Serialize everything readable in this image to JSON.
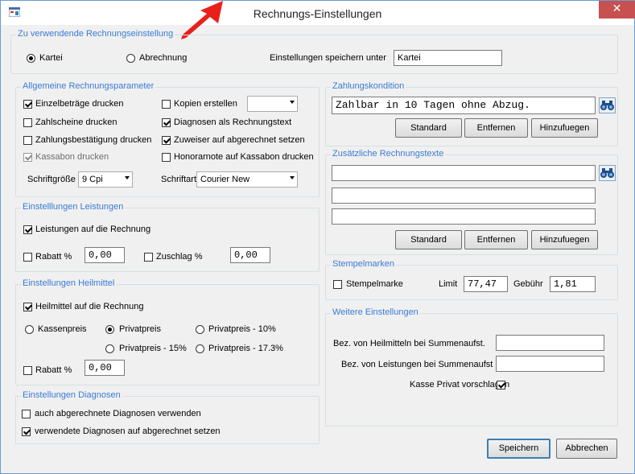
{
  "window": {
    "title": "Rechnungs-Einstellungen",
    "close_label": "✕",
    "arrow_color": "#e8201a",
    "accent_color": "#3a7bd5"
  },
  "invoice_setting": {
    "group_title": "Zu verwendende Rechnungseinstellung",
    "opt_kartei": "Kartei",
    "opt_abrechnung": "Abrechnung",
    "selected": "Kartei",
    "save_under_label": "Einstellungen speichern unter",
    "save_under_value": "Kartei"
  },
  "general": {
    "group_title": "Allgemeine Rechnungsparameter",
    "einzelbetraege": "Einzelbeträge drucken",
    "zahlscheine": "Zahlscheine drucken",
    "zahlungsbestaetigung": "Zahlungsbestätigung drucken",
    "kassabon": "Kassabon drucken",
    "kopien": "Kopien erstellen",
    "kopien_value": "",
    "diagnosen_text": "Diagnosen als Rechnungstext",
    "zuweiser": "Zuweiser auf abgerechnet setzen",
    "honorarnote": "Honorarnote auf Kassabon drucken",
    "fontsize_label": "Schriftgröße",
    "fontsize_value": "9 Cpi",
    "font_label": "Schriftart",
    "font_value": "Courier New"
  },
  "services": {
    "group_title": "Einstelllungen Leistungen",
    "on_invoice": "Leistungen auf die Rechnung",
    "rabatt_label": "Rabatt %",
    "rabatt_value": "0,00",
    "zuschlag_label": "Zuschlag %",
    "zuschlag_value": "0,00"
  },
  "remedies": {
    "group_title": "Einstellungen Heilmittel",
    "on_invoice": "Heilmittel auf die Rechnung",
    "kassenpreis": "Kassenpreis",
    "privatpreis": "Privatpreis",
    "privatpreis_10": "Privatpreis - 10%",
    "privatpreis_15": "Privatpreis - 15%",
    "privatpreis_173": "Privatpreis - 17.3%",
    "selected": "Privatpreis",
    "rabatt_label": "Rabatt %",
    "rabatt_value": "0,00"
  },
  "diagnoses": {
    "group_title": "Einstellungen Diagnosen",
    "use_billed": "auch abgerechnete Diagnosen verwenden",
    "set_billed": "verwendete Diagnosen auf abgerechnet setzen"
  },
  "payment": {
    "group_title": "Zahlungskondition",
    "value": "Zahlbar in 10 Tagen ohne Abzug.",
    "btn_standard": "Standard",
    "btn_remove": "Entfernen",
    "btn_add": "Hinzufuegen"
  },
  "extra_texts": {
    "group_title": "Zusätzliche Rechnungstexte",
    "line1": "",
    "line2": "",
    "line3": "",
    "btn_standard": "Standard",
    "btn_remove": "Entfernen",
    "btn_add": "Hinzufuegen"
  },
  "stamps": {
    "group_title": "Stempelmarken",
    "checkbox_label": "Stempelmarke",
    "limit_label": "Limit",
    "limit_value": "77,47",
    "fee_label": "Gebühr",
    "fee_value": "1,81"
  },
  "more": {
    "group_title": "Weitere Einstellungen",
    "heilmittel_label": "Bez. von Heilmitteln bei Summenaufst.",
    "heilmittel_value": "",
    "leistungen_label": "Bez. von Leistungen bei Summenaufst",
    "leistungen_value": "",
    "kasse_privat_label": "Kasse Privat vorschlagen"
  },
  "footer": {
    "save": "Speichern",
    "cancel": "Abbrechen"
  }
}
